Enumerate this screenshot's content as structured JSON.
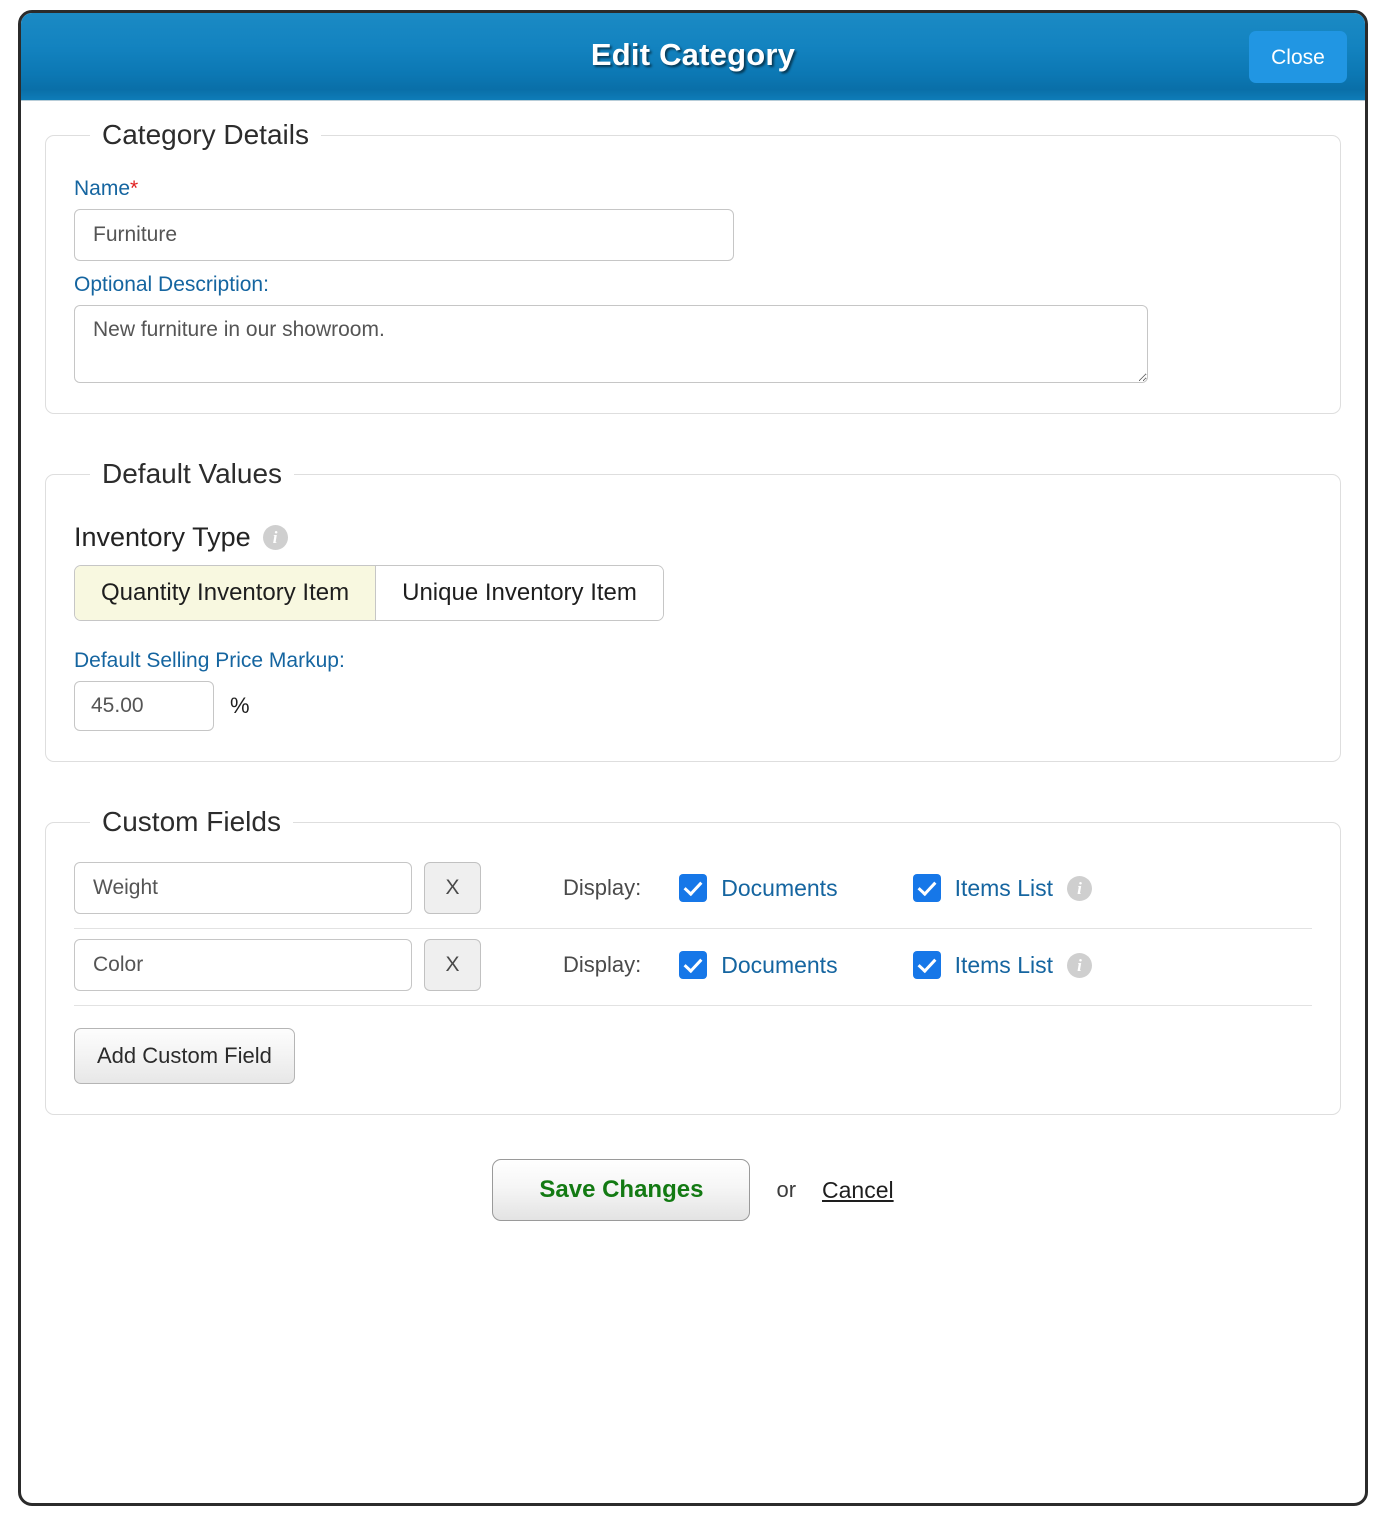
{
  "window": {
    "title": "Edit Category",
    "close_label": "Close"
  },
  "category_details": {
    "legend": "Category Details",
    "name_label": "Name",
    "name_required_mark": "*",
    "name_value": "Furniture",
    "description_label": "Optional Description:",
    "description_value": "New furniture in our showroom."
  },
  "default_values": {
    "legend": "Default Values",
    "inventory_type_label": "Inventory Type",
    "inventory_type_info_icon": "info-icon",
    "inventory_type_options": [
      {
        "label": "Quantity Inventory Item",
        "selected": true
      },
      {
        "label": "Unique Inventory Item",
        "selected": false
      }
    ],
    "markup_label": "Default Selling Price Markup:",
    "markup_value": "45.00",
    "markup_unit": "%"
  },
  "custom_fields": {
    "legend": "Custom Fields",
    "display_label": "Display:",
    "remove_label": "X",
    "documents_label": "Documents",
    "items_list_label": "Items List",
    "items_list_info_icon": "info-icon",
    "rows": [
      {
        "name": "Weight",
        "documents_checked": true,
        "items_list_checked": true
      },
      {
        "name": "Color",
        "documents_checked": true,
        "items_list_checked": true
      }
    ],
    "add_button_label": "Add Custom Field"
  },
  "footer": {
    "save_label": "Save Changes",
    "or_label": "or",
    "cancel_label": "Cancel"
  },
  "colors": {
    "titlebar_blue": "#0c78b4",
    "close_button_blue": "#2196e3",
    "link_blue": "#1565a0",
    "checkbox_blue": "#1677e8",
    "required_red": "#e02020",
    "save_green": "#137a13",
    "selected_segment_yellow": "#f8f8e0"
  }
}
